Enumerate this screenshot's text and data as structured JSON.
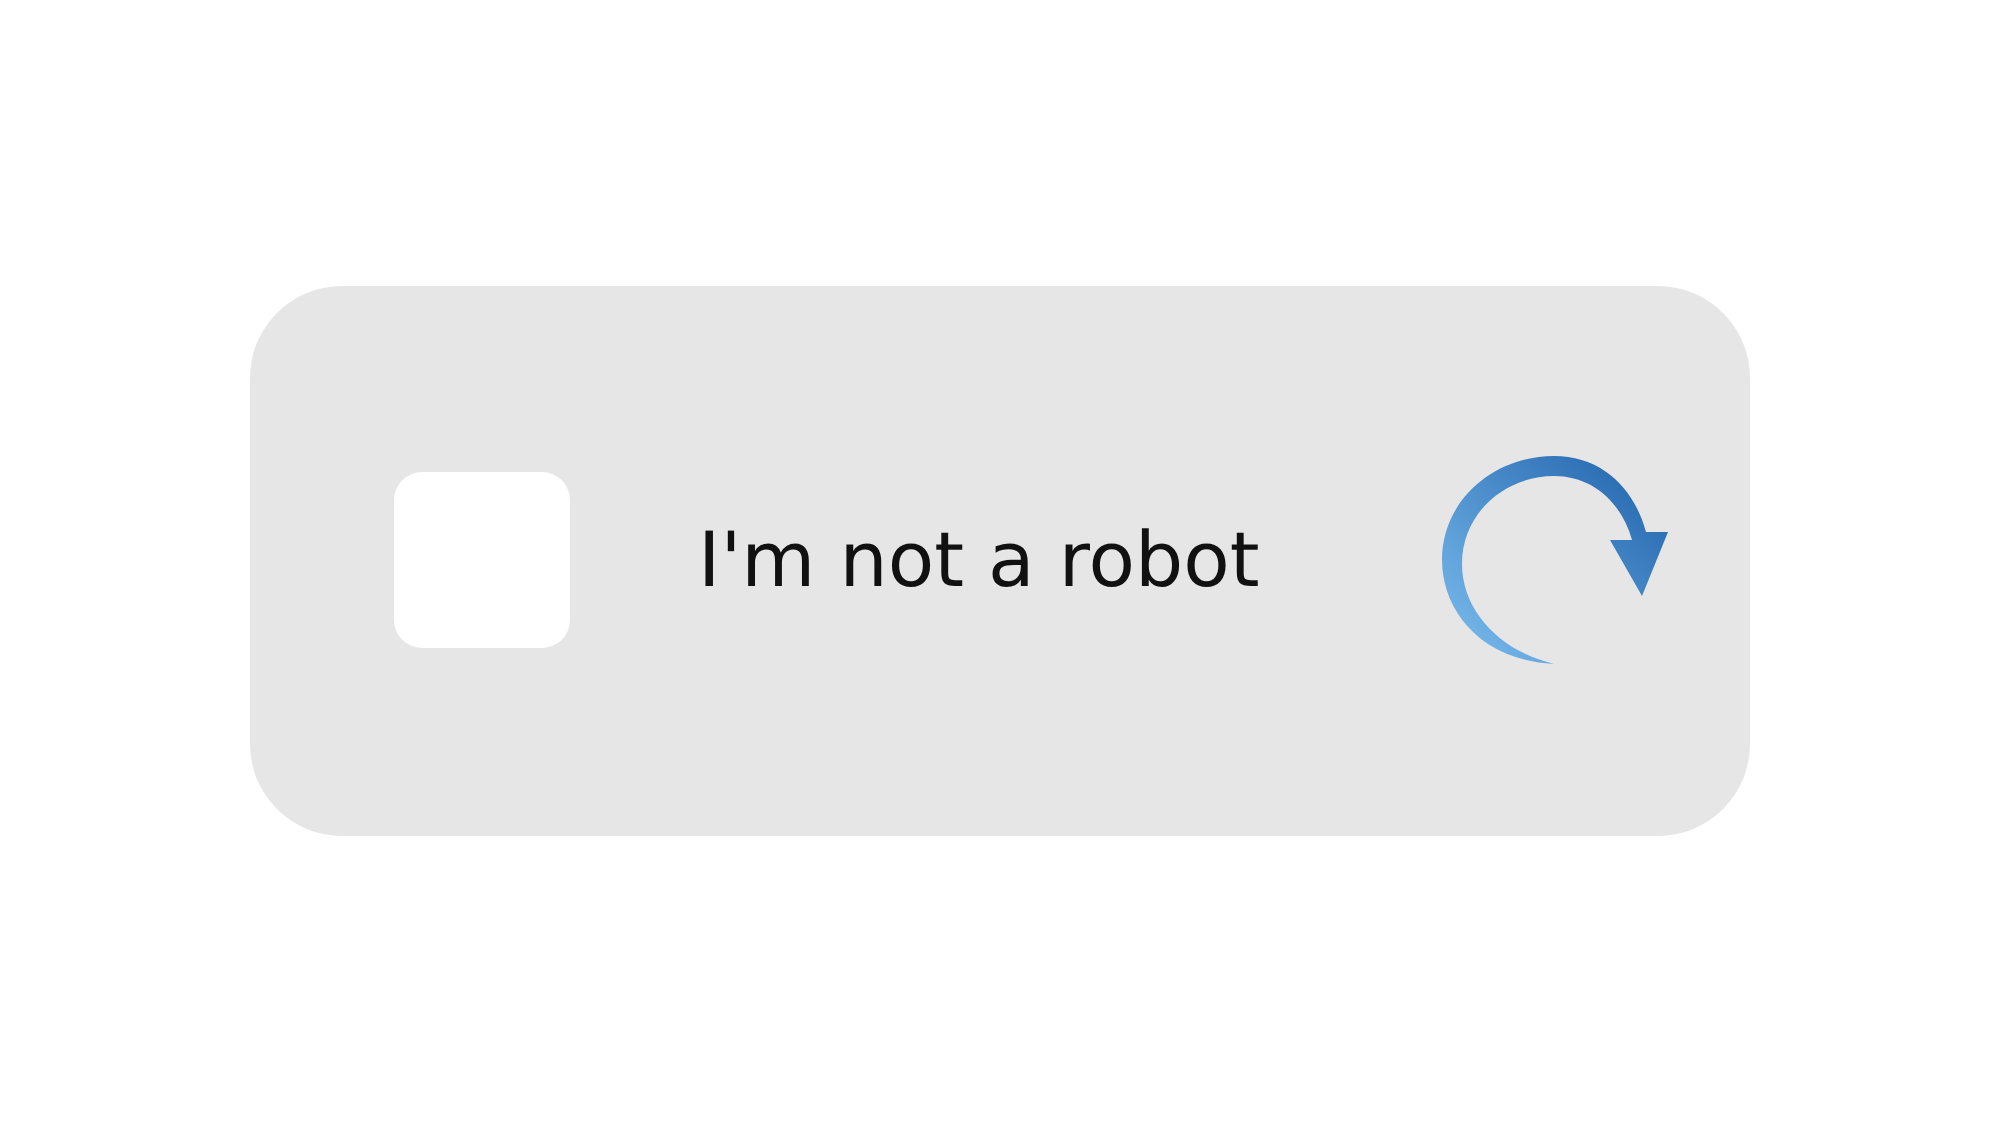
{
  "captcha": {
    "checkbox": {
      "checked": false
    },
    "label": "I'm not a robot"
  }
}
